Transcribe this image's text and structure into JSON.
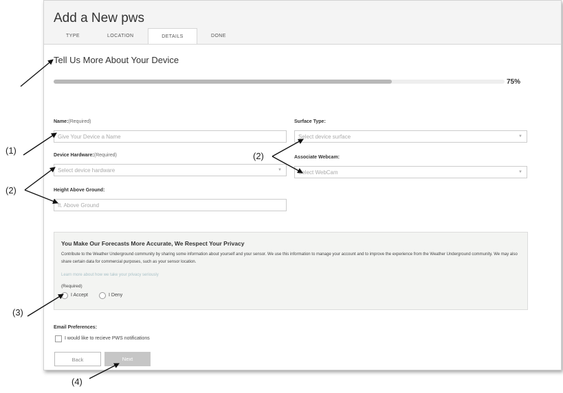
{
  "page": {
    "title": "Add a New pws"
  },
  "tabs": [
    {
      "label": "TYPE",
      "active": false
    },
    {
      "label": "LOCATION",
      "active": false
    },
    {
      "label": "DETAILS",
      "active": true
    },
    {
      "label": "DONE",
      "active": false
    }
  ],
  "section_title": "Tell Us More About Your Device",
  "progress": {
    "percent": 75,
    "label": "75%"
  },
  "form": {
    "name_label": "Name:",
    "name_required": "(Required)",
    "name_placeholder": "Give Your Device a Name",
    "hardware_label": "Device Hardware:",
    "hardware_required": "(Required)",
    "hardware_placeholder": "Select device hardware",
    "height_label": "Height Above Ground:",
    "height_placeholder": "ft. Above Ground",
    "surface_label": "Surface Type:",
    "surface_placeholder": "Select device surface",
    "webcam_label": "Associate Webcam:",
    "webcam_placeholder": "Select WebCam"
  },
  "privacy": {
    "title": "You Make Our Forecasts More Accurate, We Respect Your Privacy",
    "text": "Contribute to the Weather Underground community by sharing some information about yourself and your sensor. We use this information to manage your account and to improve the experience from the Weather Underground community. We may also share certain data for commercial purposes, such as your sensor location.",
    "link": "Learn more about how we take your privacy seriously",
    "required": "(Required)",
    "accept_label": "I Accept",
    "deny_label": "I Deny"
  },
  "email": {
    "label": "Email Preferences:",
    "checkbox_label": "I would like to recieve PWS notifications"
  },
  "buttons": {
    "back": "Back",
    "next": "Next"
  },
  "annotations": {
    "a1": "(1)",
    "a2a": "(2)",
    "a2b": "(2)",
    "a3": "(3)",
    "a4": "(4)"
  },
  "colors": {
    "next_button": "#c6c6c6",
    "progress_fill": "#b8b8b8",
    "privacy_bg": "#f3f4f2",
    "link": "#aac2c8"
  }
}
